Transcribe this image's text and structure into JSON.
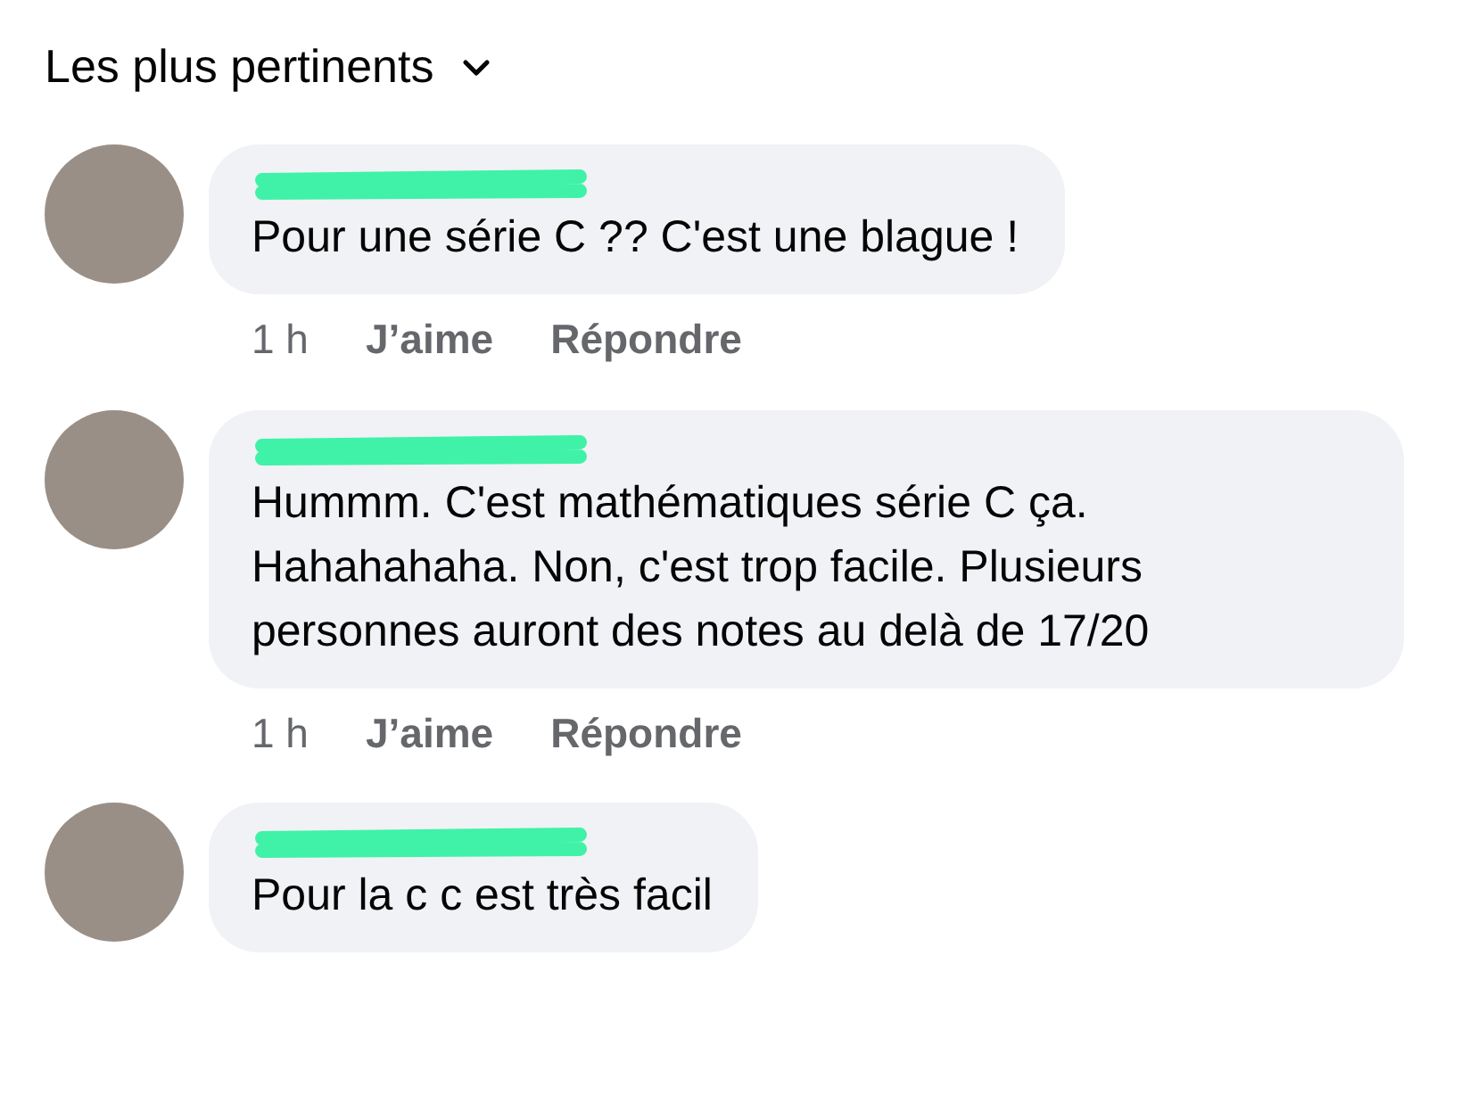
{
  "sort": {
    "label": "Les plus pertinents"
  },
  "comments": [
    {
      "text": "Pour une série C ?? C'est une blague !",
      "time": "1 h",
      "like": "J’aime",
      "reply": "Répondre"
    },
    {
      "text": "Hummm. C'est mathématiques série C ça. Hahahahaha. Non, c'est trop facile. Plusieurs personnes auront des notes au delà de 17/20",
      "time": "1 h",
      "like": "J’aime",
      "reply": "Répondre"
    },
    {
      "text": "Pour la c c est très facil"
    }
  ]
}
